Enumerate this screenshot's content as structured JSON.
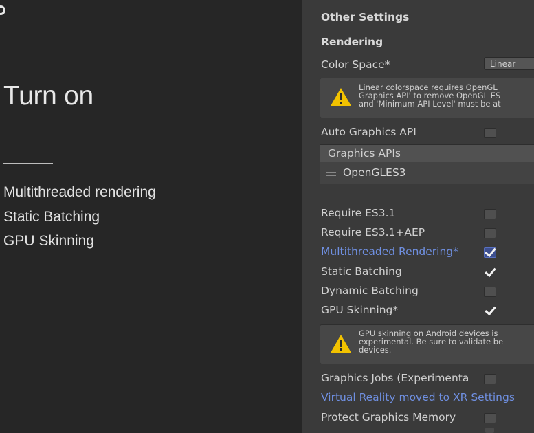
{
  "slide": {
    "title": "Turn on",
    "bullets": [
      "Multithreaded rendering",
      "Static Batching",
      "GPU Skinning"
    ]
  },
  "inspector": {
    "section_title": "Other Settings",
    "rendering_heading": "Rendering",
    "color_space": {
      "label": "Color Space*",
      "value": "Linear"
    },
    "linear_warning": {
      "lines": [
        "Linear colorspace requires OpenGL",
        "Graphics API' to remove OpenGL ES",
        "and 'Minimum API Level' must be at"
      ]
    },
    "auto_graphics_api": {
      "label": "Auto Graphics API",
      "checked": false
    },
    "graphics_apis": {
      "header": "Graphics APIs",
      "items": [
        "OpenGLES3"
      ]
    },
    "options": [
      {
        "label": "Require ES3.1",
        "checked": false
      },
      {
        "label": "Require ES3.1+AEP",
        "checked": false
      },
      {
        "label": "Multithreaded Rendering*",
        "checked": true
      },
      {
        "label": "Static Batching",
        "checked": true
      },
      {
        "label": "Dynamic Batching",
        "checked": false
      },
      {
        "label": "GPU Skinning*",
        "checked": true
      }
    ],
    "gpu_warning": {
      "lines": [
        "GPU skinning on Android devices is",
        "experimental. Be sure to validate be",
        "devices."
      ]
    },
    "graphics_jobs": {
      "label": "Graphics Jobs (Experimenta",
      "checked": false
    },
    "vr_link": "Virtual Reality moved to XR Settings",
    "protect_memory": {
      "label": "Protect Graphics Memory",
      "checked": false
    }
  },
  "colors": {
    "slide_bg": "#262626",
    "panel_bg": "#3a3a3a",
    "link": "#6f8fe0",
    "warning": "#f2c200"
  }
}
